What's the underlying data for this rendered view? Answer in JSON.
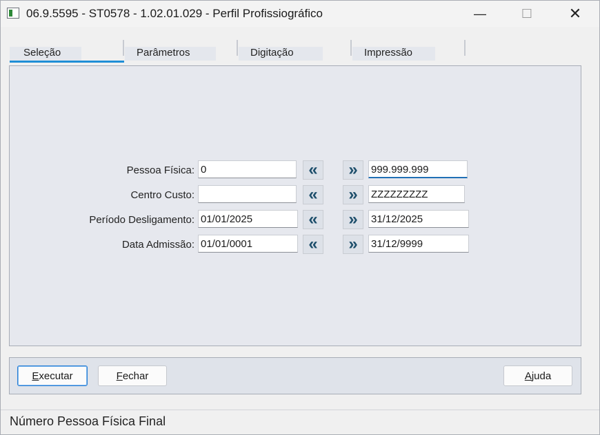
{
  "window": {
    "title": "06.9.5595 - ST0578 - 1.02.01.029 - Perfil Profissiográfico",
    "minimize_glyph": "—",
    "maximize_glyph": "☐",
    "close_glyph": "✕"
  },
  "tabs": [
    {
      "label": "Seleção",
      "selected": true
    },
    {
      "label": "Parâmetros",
      "selected": false
    },
    {
      "label": "Digitação",
      "selected": false
    },
    {
      "label": "Impressão",
      "selected": false
    }
  ],
  "form": {
    "rows": [
      {
        "label": "Pessoa Física:",
        "from": "0",
        "to": "999.999.999"
      },
      {
        "label": "Centro Custo:",
        "from": "",
        "to": "ZZZZZZZZZ"
      },
      {
        "label": "Período Desligamento:",
        "from": "01/01/2025",
        "to": "31/12/2025"
      },
      {
        "label": "Data Admissão:",
        "from": "01/01/0001",
        "to": "31/12/9999"
      }
    ],
    "first_glyph": "«",
    "last_glyph": "»"
  },
  "buttons": {
    "executar": {
      "first": "E",
      "rest": "xecutar"
    },
    "fechar": {
      "first": "F",
      "rest": "echar"
    },
    "ajuda": {
      "first": "A",
      "rest": "juda"
    }
  },
  "status": {
    "text": "Número Pessoa Física Final"
  },
  "colors": {
    "accent": "#1f8ed6",
    "arrow": "#1d4e6b"
  }
}
